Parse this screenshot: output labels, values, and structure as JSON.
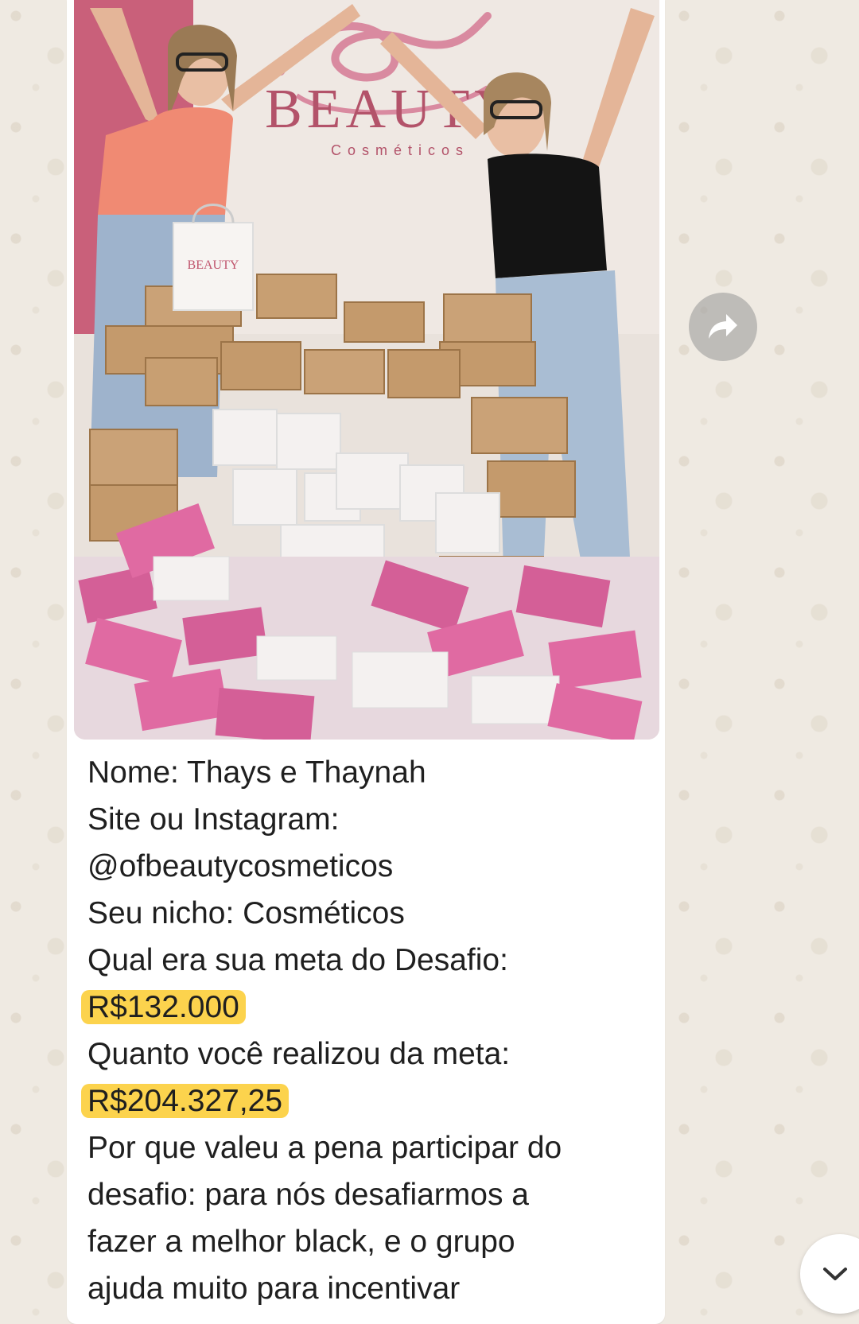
{
  "message": {
    "photo": {
      "sign_brand": "BEAUTY",
      "sign_sub": "Cosméticos",
      "bag_brand": "BEAUTY"
    },
    "caption": {
      "line1": "Nome: Thays e Thaynah",
      "line2": "Site ou Instagram:",
      "line3": "@ofbeautycosmeticos",
      "line4": "Seu nicho: Cosméticos",
      "line5": "Qual era sua meta do Desafio:",
      "goal_value": "R$132.000",
      "line7": "Quanto você realizou da meta:",
      "achieved_value": "R$204.327,25",
      "line9": "Por que valeu a pena participar do",
      "line10": "desafio: para nós desafiarmos a",
      "line11": "fazer a melhor black, e o grupo",
      "line12": "ajuda muito para incentivar"
    }
  },
  "controls": {
    "forward_icon": "forward-arrow-icon",
    "scroll_icon": "chevron-down-icon"
  },
  "colors": {
    "wallpaper": "#efeae2",
    "bubble": "#ffffff",
    "highlight": "#fcd34d",
    "text": "#1f1f1f"
  }
}
